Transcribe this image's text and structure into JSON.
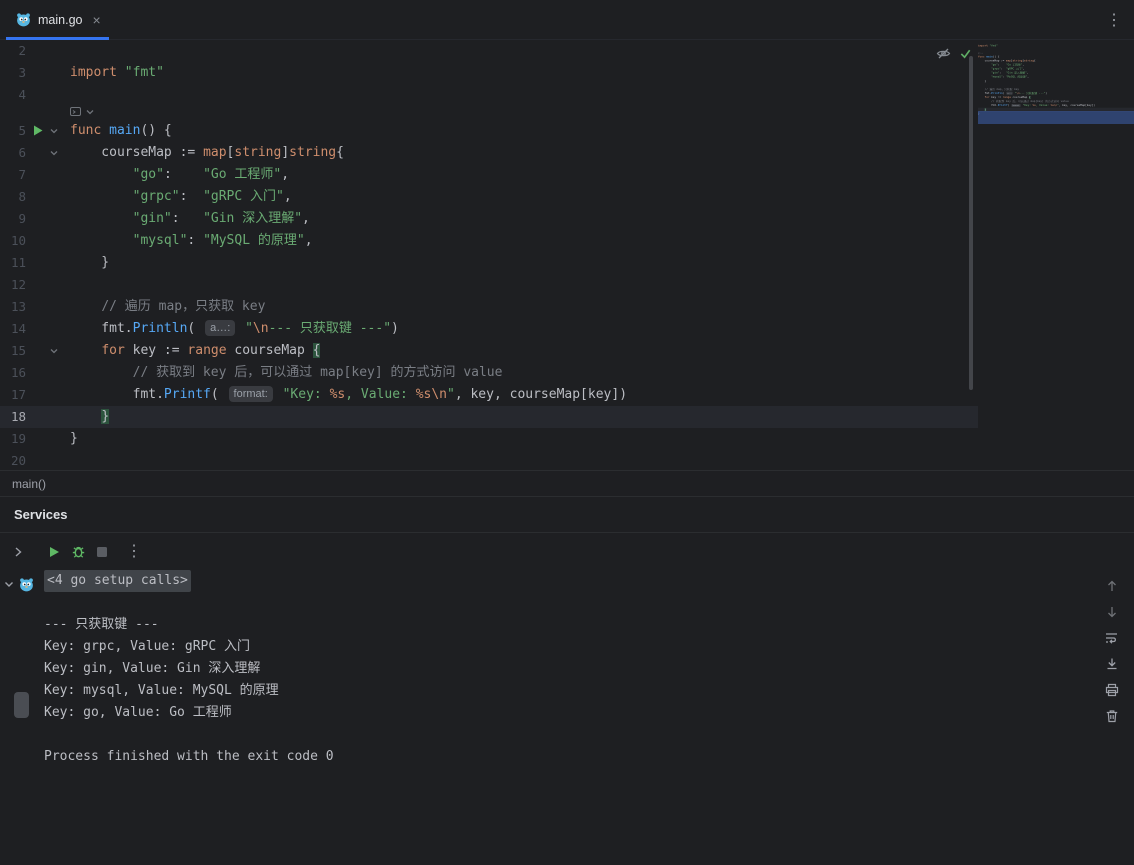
{
  "colors": {
    "accent": "#3574f0",
    "background": "#1e1f22",
    "keyword": "#cf8e6d",
    "string": "#6aab73",
    "function_call": "#56a8f5",
    "comment": "#7a7e85",
    "default_text": "#bcbec4",
    "run_green": "#5fb865"
  },
  "icons": {
    "tab_file": "go-gopher-icon",
    "tab_close": "×",
    "more_vertical": "⋮",
    "run": "play-triangle-icon",
    "debug": "bug-icon",
    "stop": "stop-square-icon",
    "reader_mode": "eye-slash-icon",
    "inspections_ok": "check-icon",
    "fold": "chevron-down-icon",
    "scroll_up": "arrow-up-icon",
    "scroll_down": "arrow-down-icon",
    "soft_wrap": "soft-wrap-icon",
    "scroll_to_end": "scroll-to-end-icon",
    "print": "printer-icon",
    "clear": "trash-icon"
  },
  "tabbar": {
    "tab": {
      "label": "main.go",
      "active": true
    }
  },
  "editor": {
    "breadcrumb": "main()",
    "lines": [
      {
        "n": 2,
        "tokens": []
      },
      {
        "n": 3,
        "tokens": [
          {
            "t": "import",
            "c": "kw"
          },
          {
            "t": " ",
            "c": "d"
          },
          {
            "t": "\"fmt\"",
            "c": "str"
          }
        ]
      },
      {
        "n": 4,
        "tokens": []
      },
      {
        "inlay": true
      },
      {
        "n": 5,
        "run": true,
        "fold": true,
        "tokens": [
          {
            "t": "func",
            "c": "kw"
          },
          {
            "t": " ",
            "c": "d"
          },
          {
            "t": "main",
            "c": "fn"
          },
          {
            "t": "() {",
            "c": "d"
          }
        ]
      },
      {
        "n": 6,
        "fold": true,
        "tokens": [
          {
            "t": "    courseMap := ",
            "c": "d"
          },
          {
            "t": "map",
            "c": "kw"
          },
          {
            "t": "[",
            "c": "d"
          },
          {
            "t": "string",
            "c": "kw"
          },
          {
            "t": "]",
            "c": "d"
          },
          {
            "t": "string",
            "c": "kw"
          },
          {
            "t": "{",
            "c": "d"
          }
        ]
      },
      {
        "n": 7,
        "tokens": [
          {
            "t": "        ",
            "c": "d"
          },
          {
            "t": "\"go\"",
            "c": "str"
          },
          {
            "t": ":    ",
            "c": "d"
          },
          {
            "t": "\"Go 工程师\"",
            "c": "str"
          },
          {
            "t": ",",
            "c": "d"
          }
        ]
      },
      {
        "n": 8,
        "tokens": [
          {
            "t": "        ",
            "c": "d"
          },
          {
            "t": "\"grpc\"",
            "c": "str"
          },
          {
            "t": ":  ",
            "c": "d"
          },
          {
            "t": "\"gRPC 入门\"",
            "c": "str"
          },
          {
            "t": ",",
            "c": "d"
          }
        ]
      },
      {
        "n": 9,
        "tokens": [
          {
            "t": "        ",
            "c": "d"
          },
          {
            "t": "\"gin\"",
            "c": "str"
          },
          {
            "t": ":   ",
            "c": "d"
          },
          {
            "t": "\"Gin 深入理解\"",
            "c": "str"
          },
          {
            "t": ",",
            "c": "d"
          }
        ]
      },
      {
        "n": 10,
        "tokens": [
          {
            "t": "        ",
            "c": "d"
          },
          {
            "t": "\"mysql\"",
            "c": "str"
          },
          {
            "t": ": ",
            "c": "d"
          },
          {
            "t": "\"MySQL 的原理\"",
            "c": "str"
          },
          {
            "t": ",",
            "c": "d"
          }
        ]
      },
      {
        "n": 11,
        "tokens": [
          {
            "t": "    }",
            "c": "d"
          }
        ]
      },
      {
        "n": 12,
        "tokens": []
      },
      {
        "n": 13,
        "tokens": [
          {
            "t": "    ",
            "c": "d"
          },
          {
            "t": "// 遍历 map，只获取 key",
            "c": "cmt"
          }
        ]
      },
      {
        "n": 14,
        "tokens": [
          {
            "t": "    fmt.",
            "c": "d"
          },
          {
            "t": "Println",
            "c": "fn"
          },
          {
            "t": "( ",
            "c": "d"
          },
          {
            "t": "a…:",
            "c": "chip"
          },
          {
            "t": " ",
            "c": "d"
          },
          {
            "t": "\"",
            "c": "str"
          },
          {
            "t": "\\n",
            "c": "esc"
          },
          {
            "t": "--- 只获取键 ---\"",
            "c": "str"
          },
          {
            "t": ")",
            "c": "d"
          }
        ]
      },
      {
        "n": 15,
        "fold": true,
        "tokens": [
          {
            "t": "    ",
            "c": "d"
          },
          {
            "t": "for",
            "c": "kw"
          },
          {
            "t": " key := ",
            "c": "d"
          },
          {
            "t": "range",
            "c": "kw"
          },
          {
            "t": " courseMap ",
            "c": "d"
          },
          {
            "t": "{",
            "c": "brace"
          }
        ]
      },
      {
        "n": 16,
        "tokens": [
          {
            "t": "        ",
            "c": "d"
          },
          {
            "t": "// 获取到 key 后，可以通过 map[key] 的方式访问 value",
            "c": "cmt"
          }
        ]
      },
      {
        "n": 17,
        "tokens": [
          {
            "t": "        fmt.",
            "c": "d"
          },
          {
            "t": "Printf",
            "c": "fn"
          },
          {
            "t": "( ",
            "c": "d"
          },
          {
            "t": "format:",
            "c": "chip"
          },
          {
            "t": " ",
            "c": "d"
          },
          {
            "t": "\"Key: ",
            "c": "str"
          },
          {
            "t": "%s",
            "c": "esc"
          },
          {
            "t": ", Value: ",
            "c": "str"
          },
          {
            "t": "%s",
            "c": "esc"
          },
          {
            "t": "\\n",
            "c": "esc"
          },
          {
            "t": "\"",
            "c": "str"
          },
          {
            "t": ", key, courseMap[key])",
            "c": "d"
          }
        ]
      },
      {
        "n": 18,
        "current": true,
        "tokens": [
          {
            "t": "    ",
            "c": "d"
          },
          {
            "t": "}",
            "c": "brace"
          }
        ]
      },
      {
        "n": 19,
        "tokens": [
          {
            "t": "}",
            "c": "d"
          }
        ]
      },
      {
        "n": 20,
        "tokens": []
      }
    ]
  },
  "services": {
    "title": "Services"
  },
  "console": {
    "rows": [
      {
        "fold": true,
        "text": "<4 go setup calls>"
      },
      {
        "text": ""
      },
      {
        "text": "--- 只获取键 ---"
      },
      {
        "text": "Key: grpc, Value: gRPC 入门"
      },
      {
        "text": "Key: gin, Value: Gin 深入理解"
      },
      {
        "text": "Key: mysql, Value: MySQL 的原理"
      },
      {
        "text": "Key: go, Value: Go 工程师"
      },
      {
        "text": ""
      },
      {
        "text": "Process finished with the exit code 0"
      }
    ]
  }
}
